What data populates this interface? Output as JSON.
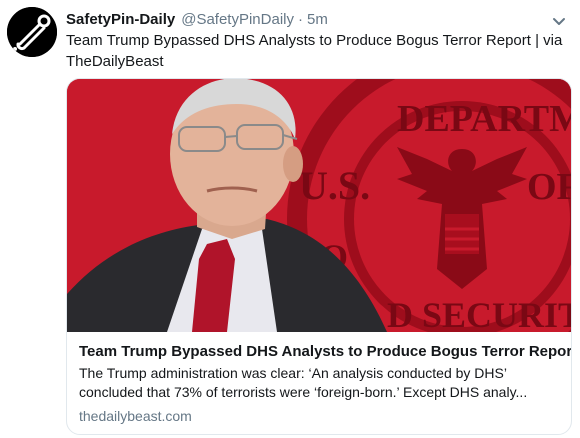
{
  "tweet": {
    "display_name": "SafetyPin-Daily",
    "handle": "@SafetyPinDaily",
    "separator": "·",
    "timestamp": "5m",
    "text": "Team Trump Bypassed DHS Analysts to Produce Bogus Terror Report  | via TheDailyBeast"
  },
  "card": {
    "title": "Team Trump Bypassed DHS Analysts to Produce Bogus Terror Report",
    "description": "The Trump administration was clear: ‘An analysis conducted by DHS’ concluded that 73% of terrorists were ‘foreign-born.’ Except DHS analy...",
    "domain": "thedailybeast.com",
    "image_seal_text": "U.S. DEPARTMENT OF HOMELAND SECURITY"
  },
  "colors": {
    "card_image_background": "#c81a2c",
    "seal_red": "#9e0d1c",
    "muted_text": "#657786"
  },
  "icons": {
    "avatar": "safety-pin-logo",
    "menu": "chevron-down-icon"
  }
}
